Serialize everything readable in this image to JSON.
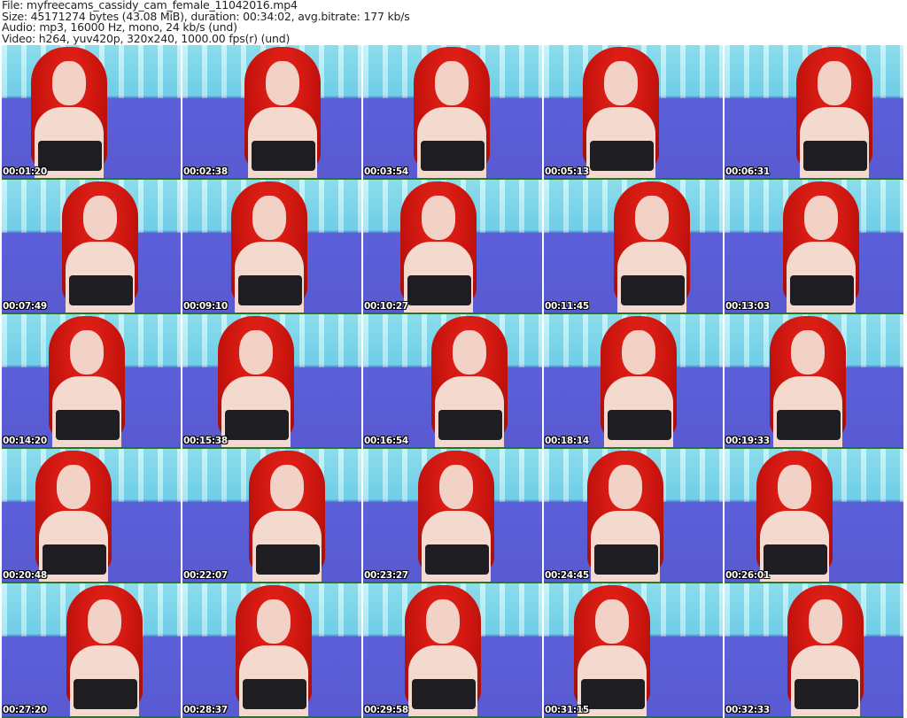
{
  "header": {
    "file": "File: myfreecams_cassidy_cam_female_11042016.mp4",
    "size": "Size: 45171274 bytes (43.08 MiB), duration: 00:34:02, avg.bitrate: 177 kb/s",
    "audio": "Audio: mp3, 16000 Hz, mono, 24 kb/s (und)",
    "video": "Video: h264, yuv420p, 320x240, 1000.00 fps(r) (und)"
  },
  "thumbnails": [
    {
      "timestamp": "00:01:20"
    },
    {
      "timestamp": "00:02:38"
    },
    {
      "timestamp": "00:03:54"
    },
    {
      "timestamp": "00:05:13"
    },
    {
      "timestamp": "00:06:31"
    },
    {
      "timestamp": "00:07:49"
    },
    {
      "timestamp": "00:09:10"
    },
    {
      "timestamp": "00:10:27"
    },
    {
      "timestamp": "00:11:45"
    },
    {
      "timestamp": "00:13:03"
    },
    {
      "timestamp": "00:14:20"
    },
    {
      "timestamp": "00:15:38"
    },
    {
      "timestamp": "00:16:54"
    },
    {
      "timestamp": "00:18:14"
    },
    {
      "timestamp": "00:19:33"
    },
    {
      "timestamp": "00:20:48"
    },
    {
      "timestamp": "00:22:07"
    },
    {
      "timestamp": "00:23:27"
    },
    {
      "timestamp": "00:24:45"
    },
    {
      "timestamp": "00:26:01"
    },
    {
      "timestamp": "00:27:20"
    },
    {
      "timestamp": "00:28:37"
    },
    {
      "timestamp": "00:29:58"
    },
    {
      "timestamp": "00:31:15"
    },
    {
      "timestamp": "00:32:33"
    }
  ]
}
